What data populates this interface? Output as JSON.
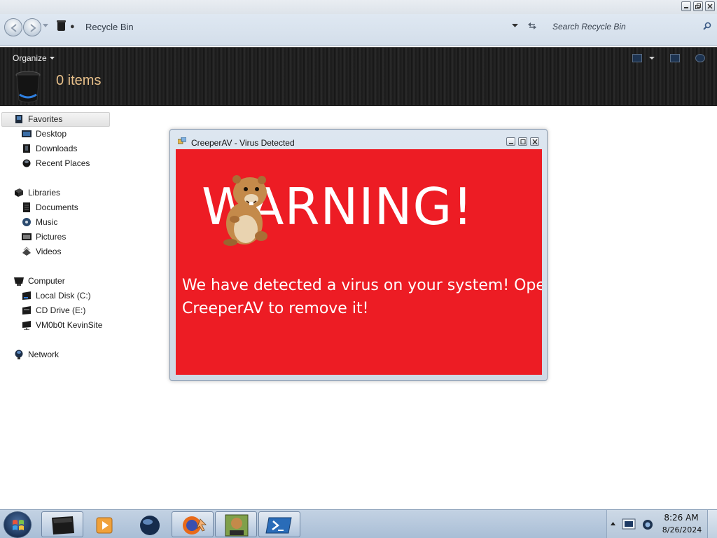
{
  "window": {
    "breadcrumb": "Recycle Bin",
    "search_placeholder": "Search Recycle Bin"
  },
  "commandbar": {
    "organize_label": "Organize",
    "items_count": "0 items"
  },
  "navpane": {
    "favorites": {
      "label": "Favorites",
      "items": [
        "Desktop",
        "Downloads",
        "Recent Places"
      ]
    },
    "libraries": {
      "label": "Libraries",
      "items": [
        "Documents",
        "Music",
        "Pictures",
        "Videos"
      ]
    },
    "computer": {
      "label": "Computer",
      "items": [
        "Local Disk (C:)",
        "CD Drive (E:)",
        "VM0b0t KevinSite"
      ]
    },
    "network": {
      "label": "Network"
    }
  },
  "dialog": {
    "title": "CreeperAV - Virus Detected",
    "warning": "WARNING!",
    "message": "We have detected a virus on your system! Open CreeperAV to remove it!",
    "body_color": "#ed1c24"
  },
  "taskbar": {
    "apps": [
      "explorer-icon",
      "media-player-icon",
      "dark-sphere-icon",
      "firefox-icon",
      "box-game-icon",
      "powershell-icon"
    ],
    "clock_time": "8:26 AM",
    "clock_date": "8/26/2024"
  }
}
